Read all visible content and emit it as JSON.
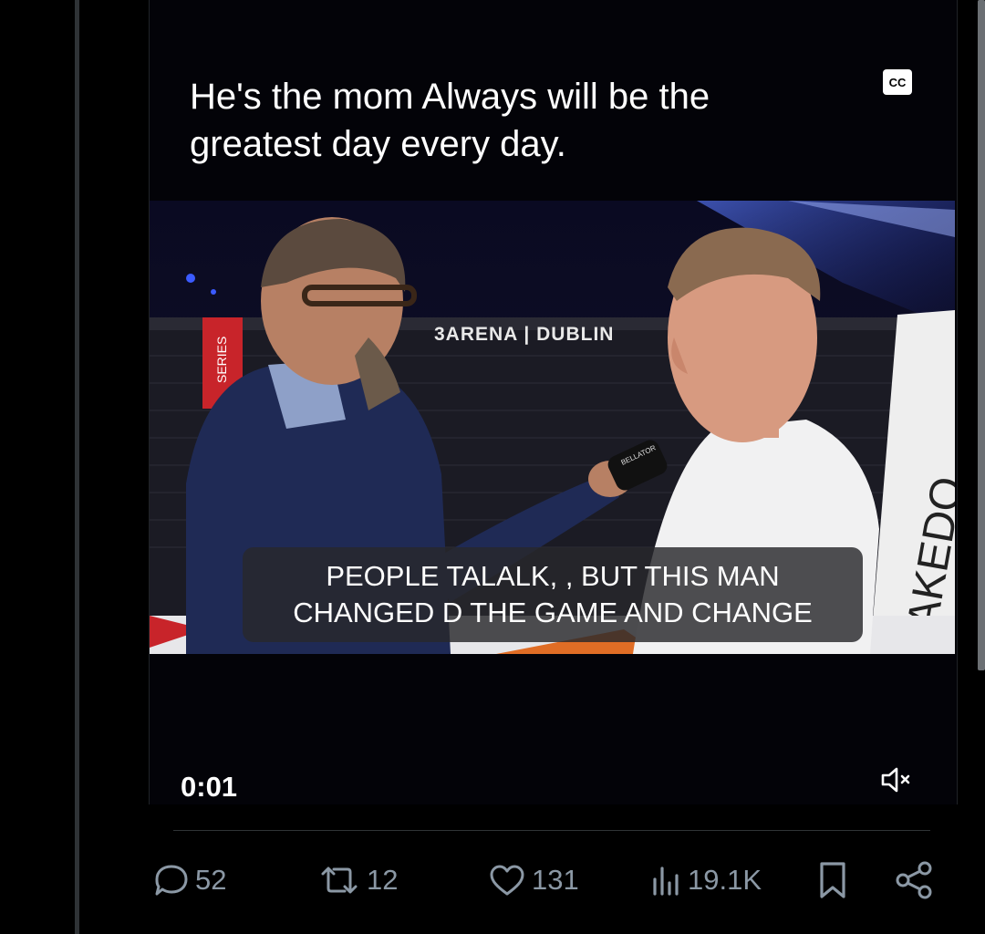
{
  "media": {
    "caption": "He's the mom Always will be the greatest day every day.",
    "cc_label": "CC",
    "subtitles": [
      "PEOPLE TALALK, , BUT THIS MAN",
      "CHANGED D THE GAME AND CHANGE"
    ],
    "scene_text": {
      "arena_banner": "3ARENA | DUBLIN",
      "series_sign": "SERIES",
      "takedown_sign": "TAKEDO",
      "mic_flag": "BELLATOR"
    },
    "timestamp": "0:01",
    "mute_icon": "speaker-muted-icon"
  },
  "actions": {
    "replies": "52",
    "reposts": "12",
    "likes": "131",
    "views": "19.1K"
  },
  "icons": {
    "reply": "speech-bubble-icon",
    "repost": "repost-arrows-icon",
    "like": "heart-icon",
    "views": "bar-chart-icon",
    "bookmark": "bookmark-icon",
    "share": "share-nodes-icon"
  },
  "colors": {
    "background": "#000000",
    "action_gray": "#8b98a5",
    "divider": "#2f3336"
  }
}
